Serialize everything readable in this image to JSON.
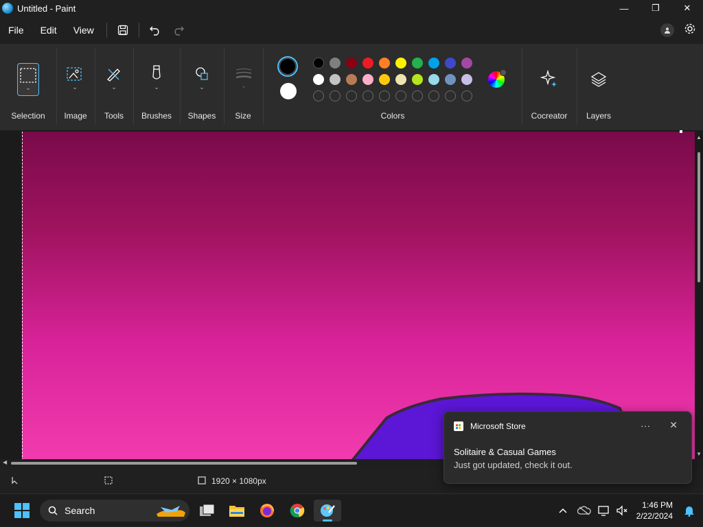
{
  "window": {
    "title": "Untitled - Paint",
    "minimize": "—",
    "maximize": "❐",
    "close": "✕"
  },
  "menu": {
    "file": "File",
    "edit": "Edit",
    "view": "View"
  },
  "ribbon": {
    "groups": {
      "selection": "Selection",
      "image": "Image",
      "tools": "Tools",
      "brushes": "Brushes",
      "shapes": "Shapes",
      "size": "Size",
      "colors": "Colors",
      "cocreator": "Cocreator",
      "layers": "Layers"
    },
    "primary_color": "#000000",
    "secondary_color": "#ffffff",
    "palette_row1": [
      "#000000",
      "#7f7f7f",
      "#880015",
      "#ed1c24",
      "#ff7f27",
      "#fff200",
      "#22b14c",
      "#00a2e8",
      "#3f48cc",
      "#a349a4"
    ],
    "palette_row2": [
      "#ffffff",
      "#c3c3c3",
      "#b97a57",
      "#ffaec9",
      "#ffc90e",
      "#efe4b0",
      "#b5e61d",
      "#99d9ea",
      "#7092be",
      "#c8bfe7"
    ]
  },
  "status": {
    "canvas_size": "1920 × 1080px"
  },
  "toast": {
    "app": "Microsoft Store",
    "title": "Solitaire & Casual Games",
    "body": "Just got updated, check it out.",
    "more": "···",
    "close": "✕"
  },
  "taskbar": {
    "search_label": "Search",
    "time": "1:46 PM",
    "date": "2/22/2024"
  },
  "colors": {
    "accent": "#4cc2ff",
    "canvas_top": "#7a0a4a",
    "canvas_bottom": "#f23bae",
    "shape_fill": "#5b16d6"
  }
}
